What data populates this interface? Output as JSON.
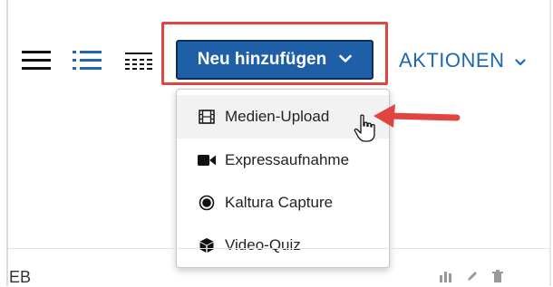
{
  "toolbar": {
    "add_button_label": "Neu hinzufügen",
    "actions_label": "AKTIONEN"
  },
  "dropdown": {
    "items": [
      {
        "label": "Medien-Upload",
        "icon": "film-icon"
      },
      {
        "label": "Expressaufnahme",
        "icon": "video-camera-icon"
      },
      {
        "label": "Kaltura Capture",
        "icon": "record-circle-icon"
      },
      {
        "label": "Video-Quiz",
        "icon": "cube-icon"
      }
    ]
  },
  "content": {
    "partial_label": "EB"
  },
  "colors": {
    "button_bg": "#1f5fa8",
    "link_blue": "#1f67b1",
    "highlight_red": "#e0453f"
  }
}
